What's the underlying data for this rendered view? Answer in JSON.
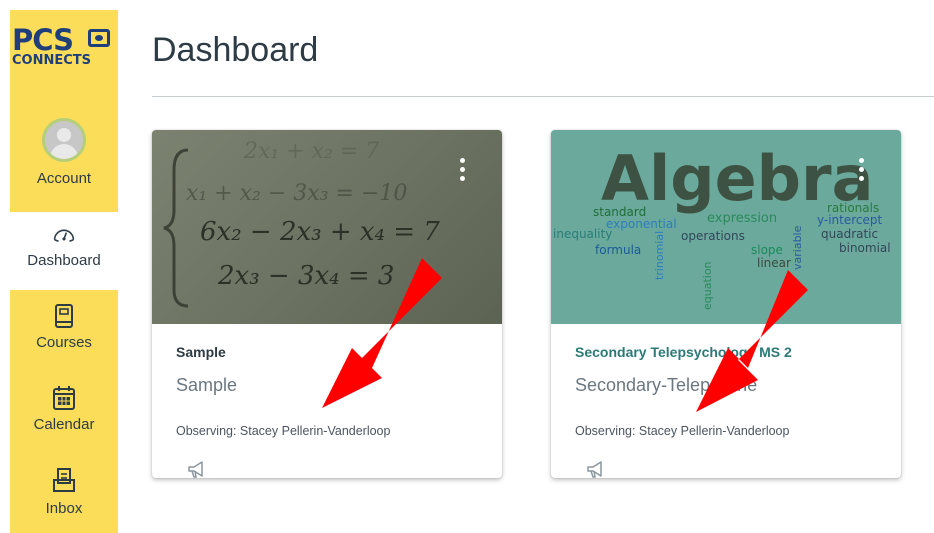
{
  "nav": {
    "logo": {
      "top": "PCS",
      "bottom": "CONNECTS"
    },
    "items": [
      {
        "label": "Account",
        "icon": "user-avatar-icon"
      },
      {
        "label": "Dashboard",
        "icon": "dashboard-gauge-icon"
      },
      {
        "label": "Courses",
        "icon": "book-icon"
      },
      {
        "label": "Calendar",
        "icon": "calendar-icon"
      },
      {
        "label": "Inbox",
        "icon": "inbox-icon"
      }
    ],
    "colors": {
      "bar": "#fbdd5a",
      "logo": "#1f3f7a"
    }
  },
  "header": {
    "title": "Dashboard"
  },
  "cards": [
    {
      "course_code": "Sample",
      "course_name": "Sample",
      "observing": "Observing: Stacey Pellerin-Vanderloop",
      "image_text": [
        "2x₁ + x₂ = 7",
        "x₁ + x₂ − 3x₃ = −10",
        "6x₂ − 2x₃ + x₄ = 7",
        "2x₃ − 3x₄ = 3"
      ],
      "icon": "announcement-megaphone-icon"
    },
    {
      "course_code": "Secondary Telepsychology MS 2",
      "course_name": "Secondary-Telepsyche",
      "observing": "Observing: Stacey Pellerin-Vanderloop",
      "image_words": {
        "main": "Algebra",
        "words": [
          "standard",
          "expression",
          "exponential",
          "rationals",
          "inequality",
          "operations",
          "y-intercept",
          "formula",
          "slope",
          "quadratic",
          "linear",
          "binomial",
          "trinomial",
          "equation",
          "variable"
        ]
      },
      "icon": "announcement-megaphone-icon",
      "accent": "#2b7a78"
    }
  ],
  "annotation": {
    "arrow_color": "#ff0000"
  }
}
